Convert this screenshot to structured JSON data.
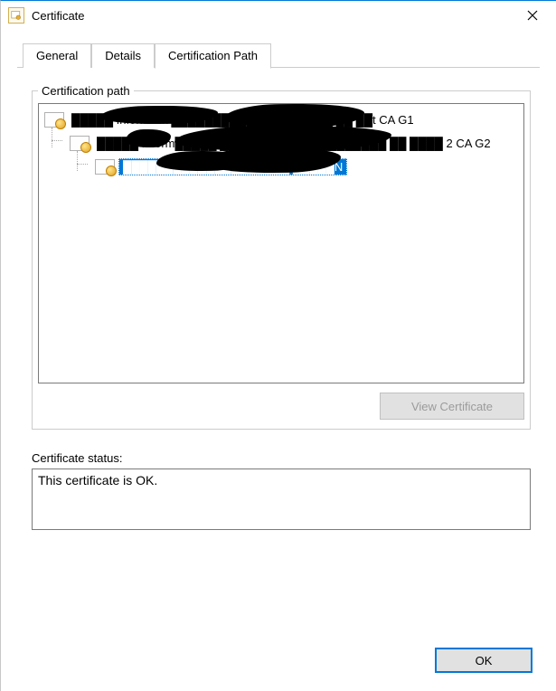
{
  "window": {
    "title": "Certificate"
  },
  "tabs": {
    "general": "General",
    "details": "Details",
    "certpath": "Certification Path"
  },
  "certpath": {
    "legend": "Certification path",
    "tree": [
      {
        "label": "█████ Informatik ██████████████ █████ ██ ██t CA G1",
        "level": 0,
        "selected": false
      },
      {
        "label": "█████ Inform█████ ████████████████████ ██ ████ 2 CA G2",
        "level": 1,
        "selected": false
      },
      {
        "label": "████████████████████ █████N",
        "level": 2,
        "selected": true
      }
    ],
    "view_button": "View Certificate"
  },
  "status": {
    "label": "Certificate status:",
    "value": "This certificate is OK."
  },
  "buttons": {
    "ok": "OK"
  }
}
